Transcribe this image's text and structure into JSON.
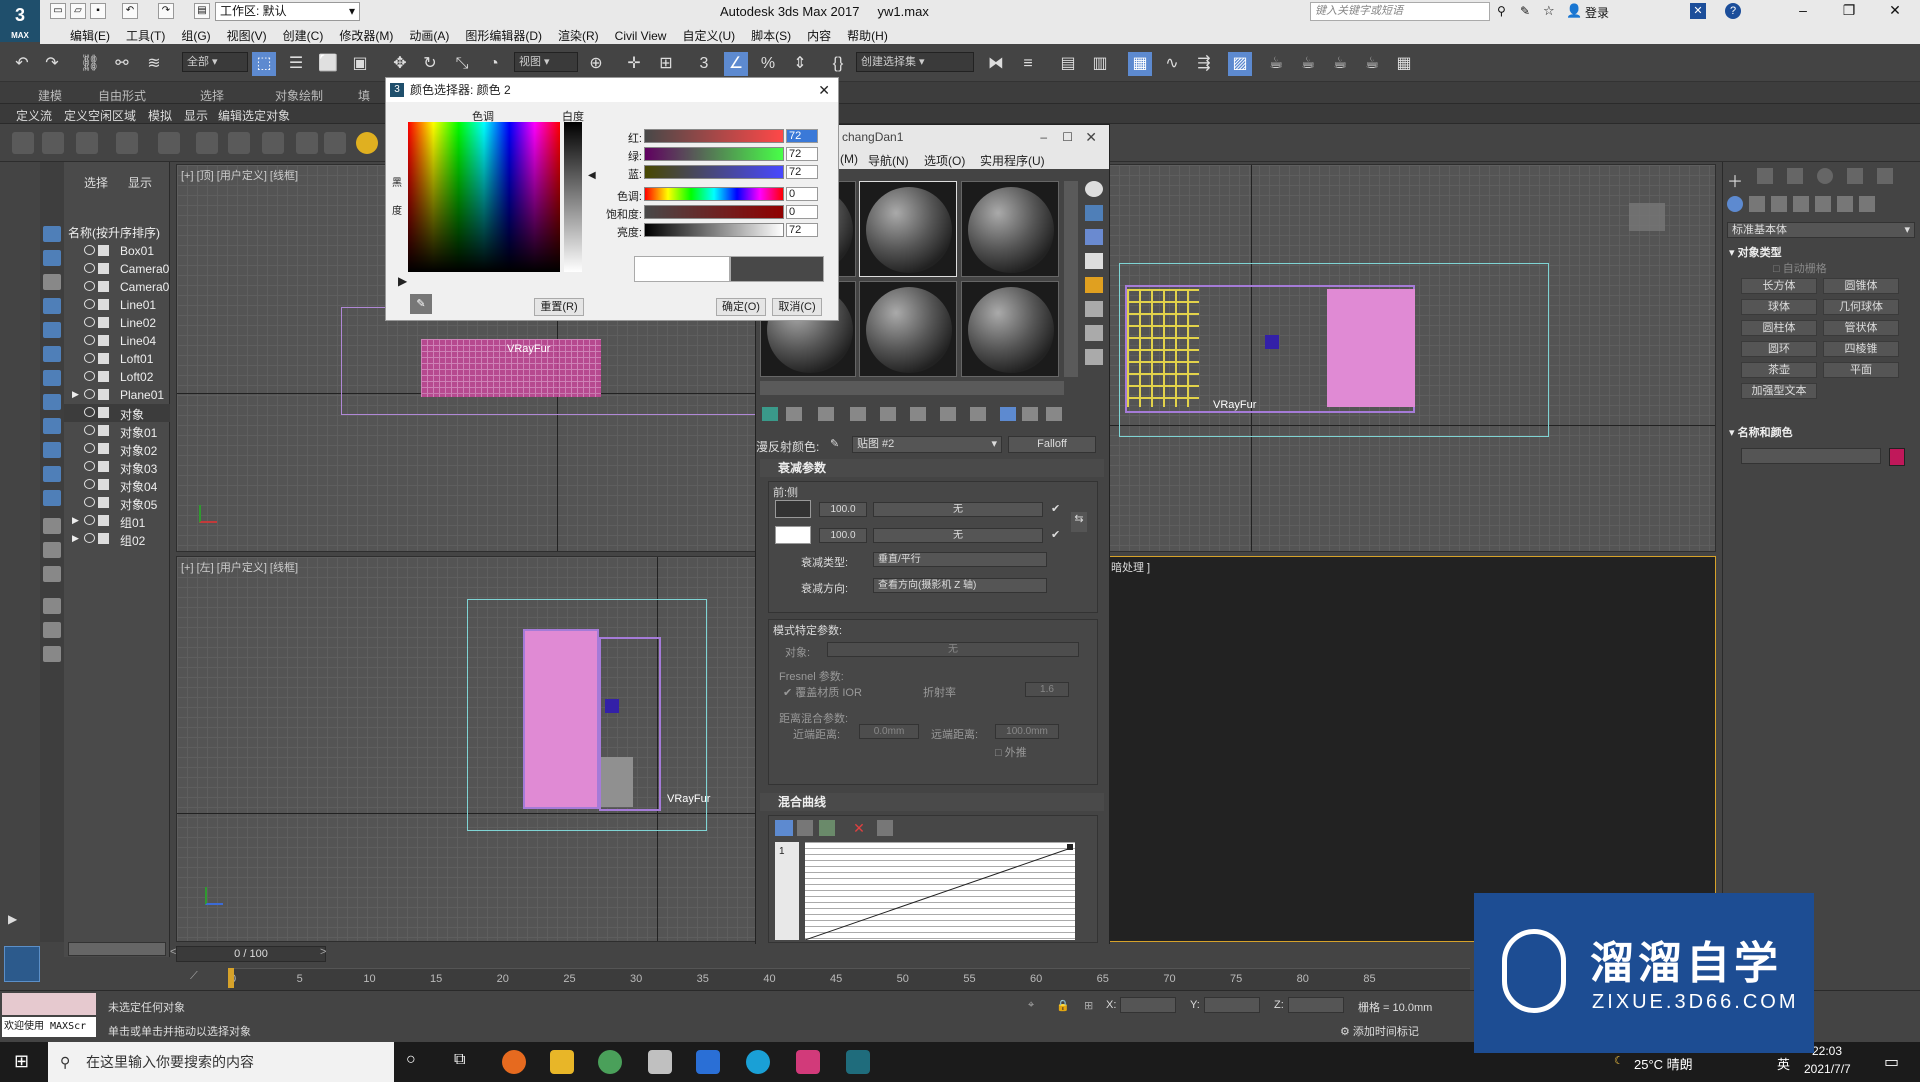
{
  "app": {
    "logo_text": "3",
    "logo_sub": "MAX",
    "workspace": "工作区: 默认",
    "title": "Autodesk 3ds Max 2017",
    "filename": "yw1.max",
    "search_placeholder": "键入关键字或短语",
    "login": "登录",
    "window_buttons": [
      "–",
      "❐",
      "✕"
    ]
  },
  "menubar": {
    "items": [
      "编辑(E)",
      "工具(T)",
      "组(G)",
      "视图(V)",
      "创建(C)",
      "修改器(M)",
      "动画(A)",
      "图形编辑器(D)",
      "渲染(R)",
      "Civil View",
      "自定义(U)",
      "脚本(S)",
      "内容",
      "帮助(H)"
    ]
  },
  "toolbar": {
    "filter": "全部",
    "view": "视图",
    "selection_set": "创建选择集"
  },
  "ribbon": {
    "tabs": [
      "建模",
      "自由形式",
      "选择",
      "对象绘制",
      "填"
    ],
    "sub": [
      "定义流",
      "定义空闲区域",
      "模拟",
      "显示",
      "编辑选定对象"
    ]
  },
  "explorer": {
    "tabs": [
      "选择",
      "显示"
    ],
    "header": "名称(按升序排序)",
    "items": [
      {
        "name": "Box01",
        "expand": ""
      },
      {
        "name": "Camera0",
        "expand": ""
      },
      {
        "name": "Camera0",
        "expand": ""
      },
      {
        "name": "Line01",
        "expand": ""
      },
      {
        "name": "Line02",
        "expand": ""
      },
      {
        "name": "Line04",
        "expand": ""
      },
      {
        "name": "Loft01",
        "expand": ""
      },
      {
        "name": "Loft02",
        "expand": ""
      },
      {
        "name": "Plane01",
        "expand": "▶"
      },
      {
        "name": "对象",
        "expand": ""
      },
      {
        "name": "对象01",
        "expand": ""
      },
      {
        "name": "对象02",
        "expand": ""
      },
      {
        "name": "对象03",
        "expand": ""
      },
      {
        "name": "对象04",
        "expand": ""
      },
      {
        "name": "对象05",
        "expand": ""
      },
      {
        "name": "组01",
        "expand": "▶"
      },
      {
        "name": "组02",
        "expand": "▶"
      }
    ]
  },
  "viewports": {
    "top": "[+] [顶] [用户定义] [线框]",
    "left": "[+] [左] [用户定义] [线框]",
    "persp": "[+] [透视] [用户定义] [默认明暗处理]",
    "camera_tail": "暗处理 ]",
    "vrayfur": "VRayFur"
  },
  "color_picker": {
    "title": "颜色选择器: 颜色 2",
    "hue_label": "色调",
    "white_label": "白度",
    "black_label": "黑",
    "degree_label": "度",
    "channels": [
      {
        "label": "红:",
        "value": "72"
      },
      {
        "label": "绿:",
        "value": "72"
      },
      {
        "label": "蓝:",
        "value": "72"
      },
      {
        "label": "色调:",
        "value": "0"
      },
      {
        "label": "饱和度:",
        "value": "0"
      },
      {
        "label": "亮度:",
        "value": "72"
      }
    ],
    "reset": "重置(R)",
    "ok": "确定(O)",
    "cancel": "取消(C)"
  },
  "material_editor": {
    "title": "changDan1",
    "menu": [
      "(M)",
      "导航(N)",
      "选项(O)",
      "实用程序(U)"
    ],
    "diffuse_label": "漫反射颜色:",
    "map_name": "贴图 #2",
    "map_type": "Falloff",
    "rollout_falloff": "衰减参数",
    "front_side": "前:侧",
    "amount1": "100.0",
    "amount2": "100.0",
    "none": "无",
    "falloff_type_label": "衰减类型:",
    "falloff_type": "垂直/平行",
    "falloff_dir_label": "衰减方向:",
    "falloff_dir": "查看方向(摄影机 Z 轴)",
    "mode_params": "模式特定参数:",
    "object_label": "对象:",
    "fresnel": "Fresnel 参数:",
    "override_ior": "覆盖材质 IOR",
    "ior_label": "折射率",
    "ior_value": "1.6",
    "dist_blend": "距离混合参数:",
    "near_label": "近端距离:",
    "near_value": "0.0mm",
    "far_label": "远端距离:",
    "far_value": "100.0mm",
    "extrapolate": "外推",
    "rollout_curve": "混合曲线",
    "curve_index": "1"
  },
  "command_panel": {
    "dropdown": "标准基本体",
    "object_type": "对象类型",
    "autogrid": "自动栅格",
    "buttons": [
      "长方体",
      "圆锥体",
      "球体",
      "几何球体",
      "圆柱体",
      "管状体",
      "圆环",
      "四棱锥",
      "茶壶",
      "平面",
      "加强型文本"
    ],
    "name_color": "名称和颜色",
    "swatch_color": "#c0185a"
  },
  "timeline": {
    "frame": "0 / 100",
    "ticks": [
      "0",
      "5",
      "10",
      "15",
      "20",
      "25",
      "30",
      "35",
      "40",
      "45",
      "50",
      "55",
      "60",
      "65",
      "70",
      "75",
      "80",
      "85"
    ]
  },
  "status": {
    "welcome": "欢迎使用 MAXScr",
    "line1": "未选定任何对象",
    "line2": "单击或单击并拖动以选择对象",
    "x": "X:",
    "y": "Y:",
    "z": "Z:",
    "grid": "栅格 = 10.0mm",
    "add_time_tag": "添加时间标记"
  },
  "taskbar": {
    "search": "在这里输入你要搜索的内容",
    "weather": "25°C 晴朗",
    "ime": "英",
    "time": "22:03",
    "date": "2021/7/7"
  },
  "watermark": {
    "brand": "溜溜自学",
    "url": "ZIXUE.3D66.COM"
  }
}
